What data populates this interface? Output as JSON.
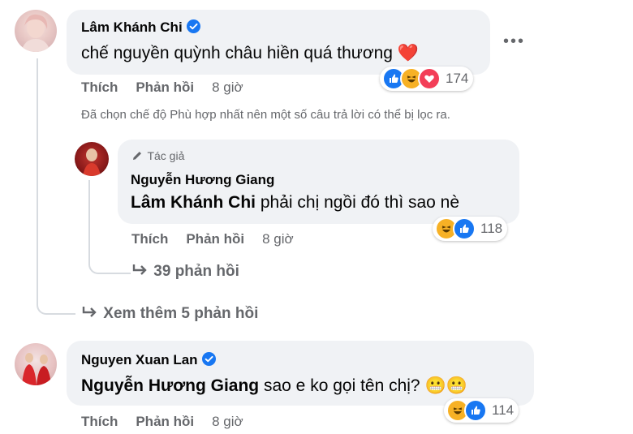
{
  "comments": [
    {
      "author": "Lâm Khánh Chi",
      "verified": true,
      "text": "chế nguyền quỳnh châu hiền quá thương ❤️",
      "actions": {
        "like": "Thích",
        "reply": "Phản hồi",
        "time": "8 giờ"
      },
      "reaction_count": "174",
      "reactions": [
        "like-icon",
        "haha-icon",
        "love-icon"
      ]
    },
    {
      "author": "Nguyễn Hương Giang",
      "badge": "Tác giả",
      "mention": "Lâm Khánh Chi",
      "text": "phải chị ngồi đó thì sao nè",
      "actions": {
        "like": "Thích",
        "reply": "Phản hồi",
        "time": "8 giờ"
      },
      "reaction_count": "118",
      "reactions": [
        "haha-icon",
        "like-icon"
      ]
    },
    {
      "author": "Nguyen Xuan Lan",
      "verified": true,
      "mention": "Nguyễn Hương Giang",
      "text": "sao e ko gọi tên chị? 😬😬",
      "actions": {
        "like": "Thích",
        "reply": "Phản hồi",
        "time": "8 giờ"
      },
      "reaction_count": "114",
      "reactions": [
        "haha-icon",
        "like-icon"
      ]
    }
  ],
  "filter_notice": "Đã chọn chế độ Phù hợp nhất nên một số câu trả lời có thể bị lọc ra.",
  "nested_replies_link": "39 phản hồi",
  "more_replies_link": "Xem thêm 5 phản hồi",
  "more_options": "•••",
  "colors": {
    "accent": "#1877f2",
    "bubble": "#f0f2f5",
    "muted": "#65676b",
    "love": "#f33e58",
    "haha": "#f7b125"
  }
}
